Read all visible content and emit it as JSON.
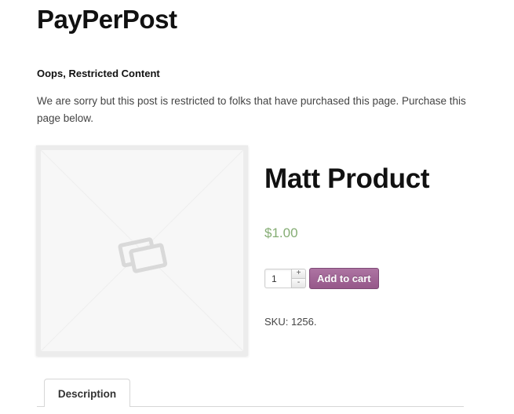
{
  "site": {
    "title": "PayPerPost"
  },
  "notice": {
    "heading": "Oops, Restricted Content",
    "body": "We are sorry but this post is restricted to folks that have purchased this page. Purchase this page below."
  },
  "product": {
    "image_icon": "placeholder-image-icon",
    "title": "Matt Product",
    "price": "$1.00",
    "quantity": "1",
    "qty_plus": "+",
    "qty_minus": "-",
    "add_to_cart_label": "Add to cart",
    "sku": "SKU: 1256."
  },
  "tabs": [
    {
      "label": "Description",
      "active": true
    }
  ],
  "colors": {
    "price": "#85ad74",
    "button": "#96588a"
  }
}
